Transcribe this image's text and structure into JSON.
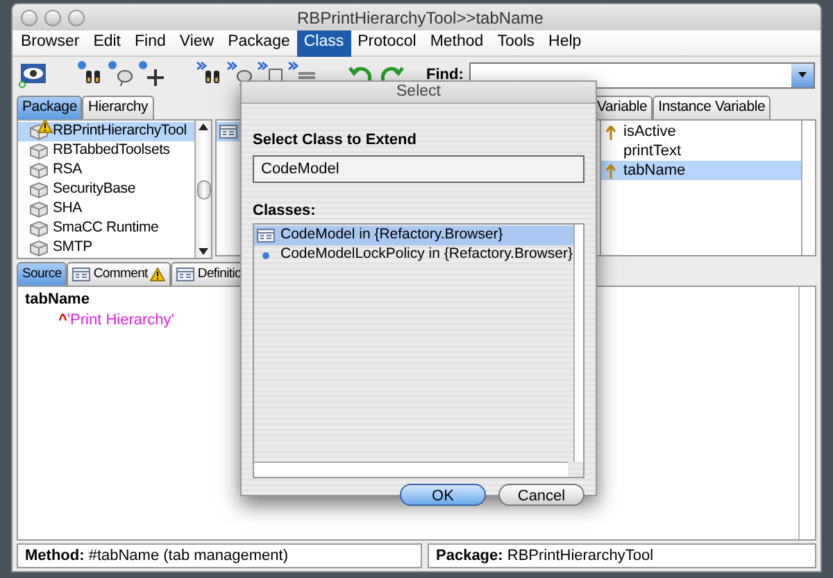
{
  "window": {
    "title": "RBPrintHierarchyTool>>tabName"
  },
  "menu": [
    {
      "label": "Browser",
      "selected": false
    },
    {
      "label": "Edit",
      "selected": false
    },
    {
      "label": "Find",
      "selected": false
    },
    {
      "label": "View",
      "selected": false
    },
    {
      "label": "Package",
      "selected": false
    },
    {
      "label": "Class",
      "selected": true
    },
    {
      "label": "Protocol",
      "selected": false
    },
    {
      "label": "Method",
      "selected": false
    },
    {
      "label": "Tools",
      "selected": false
    },
    {
      "label": "Help",
      "selected": false
    }
  ],
  "find": {
    "label": "Find:"
  },
  "package_tabs": [
    {
      "label": "Package",
      "selected": true
    },
    {
      "label": "Hierarchy",
      "selected": false
    }
  ],
  "packages": [
    {
      "label": "RBPrintHierarchyTool",
      "selected": true,
      "warning": true
    },
    {
      "label": "RBTabbedToolsets",
      "selected": false,
      "warning": false
    },
    {
      "label": "RSA",
      "selected": false,
      "warning": false
    },
    {
      "label": "SecurityBase",
      "selected": false,
      "warning": false
    },
    {
      "label": "SHA",
      "selected": false,
      "warning": false
    },
    {
      "label": "SmaCC Runtime",
      "selected": false,
      "warning": false
    },
    {
      "label": "SMTP",
      "selected": false,
      "warning": false
    }
  ],
  "variable_tabs": [
    {
      "label": "Variable",
      "selected": false
    },
    {
      "label": "Instance Variable",
      "selected": false
    }
  ],
  "variables": [
    {
      "label": "isActive",
      "selected": false,
      "kind": "inherited"
    },
    {
      "label": "printText",
      "selected": false,
      "kind": "local"
    },
    {
      "label": "tabName",
      "selected": true,
      "kind": "inherited"
    }
  ],
  "editor_tabs": [
    {
      "label": "Source",
      "selected": true,
      "warning": false
    },
    {
      "label": "Comment",
      "selected": false,
      "warning": true
    },
    {
      "label": "Definitio",
      "selected": false,
      "warning": false
    }
  ],
  "code": {
    "method": "tabName",
    "return_mark": "^",
    "string": "'Print Hierarchy'"
  },
  "status_bar": [
    "**Method:** #tabName (tab management)",
    "**Package:** RBPrintHierarchyTool"
  ],
  "dialog": {
    "title": "Select",
    "prompt": "Select Class to Extend",
    "value": "CodeModel",
    "list_label": "Classes:",
    "classes": [
      {
        "label": "CodeModel in {Refactory.Browser}",
        "selected": true,
        "kind": "class"
      },
      {
        "label": "CodeModelLockPolicy in {Refactory.Browser}",
        "selected": false,
        "kind": "shared"
      }
    ],
    "buttons": [
      {
        "label": "OK",
        "default": true
      },
      {
        "label": "Cancel",
        "default": false
      }
    ]
  }
}
